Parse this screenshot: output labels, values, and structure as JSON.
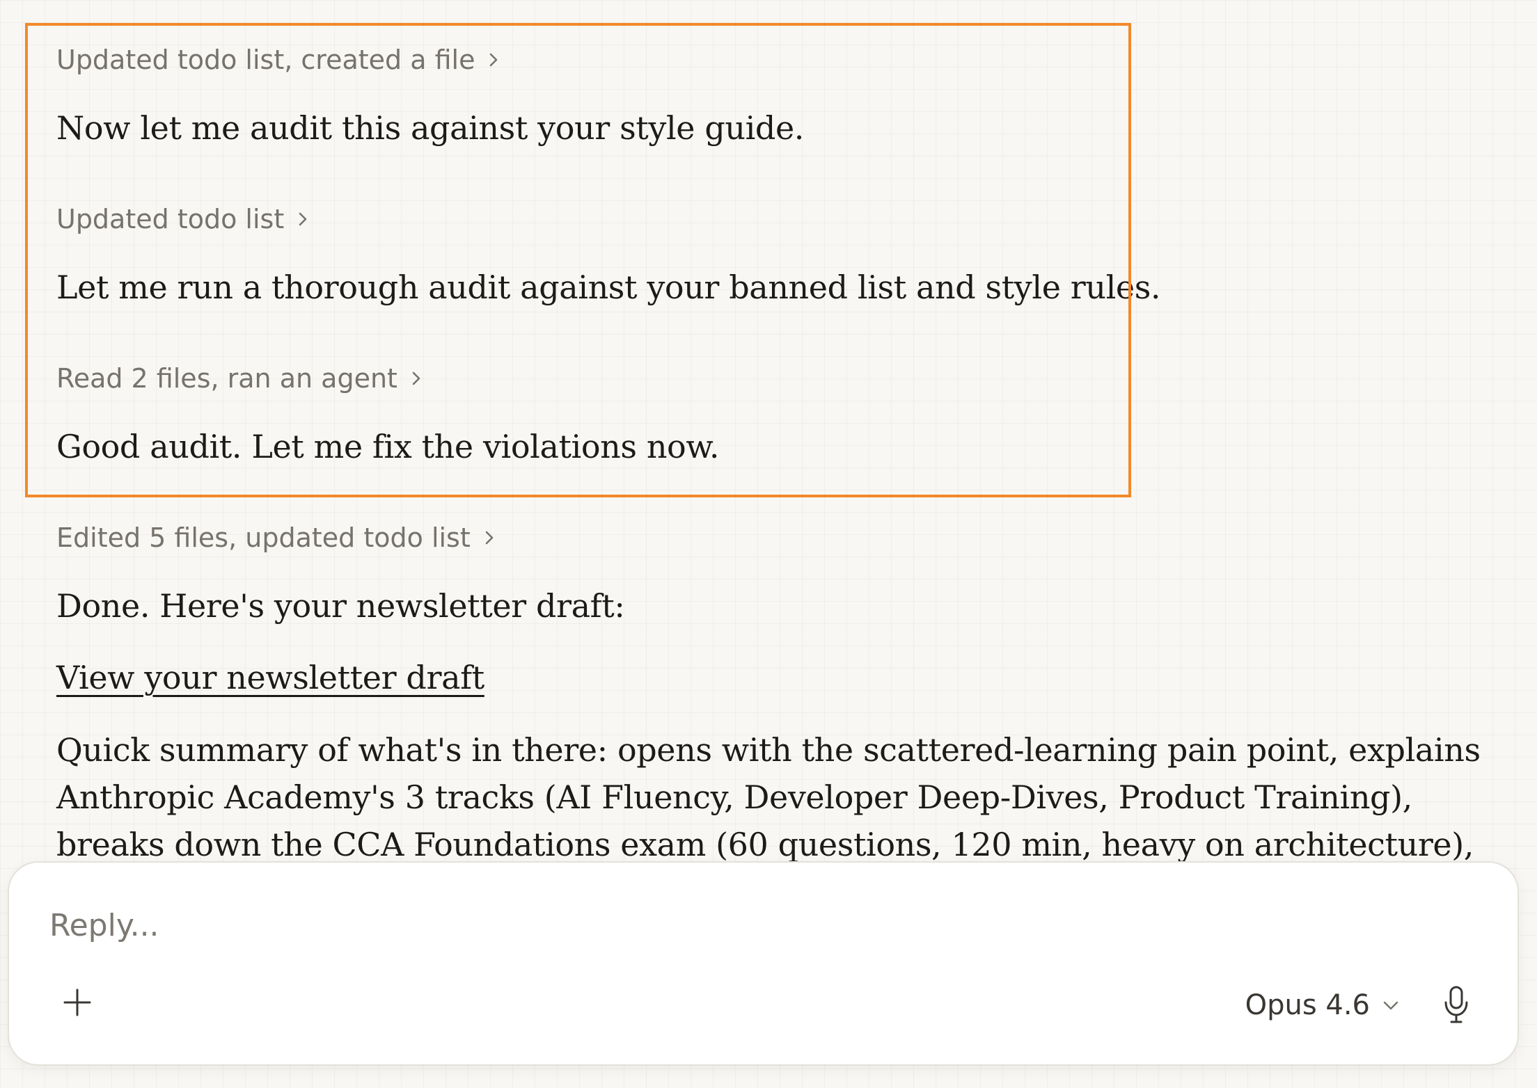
{
  "messages": {
    "step1": "Updated todo list, created a file",
    "msg1": "Now let me audit this against your style guide.",
    "step2": "Updated todo list",
    "msg2": "Let me run a thorough audit against your banned list and style rules.",
    "step3": "Read 2 files, ran an agent",
    "msg3": "Good audit. Let me fix the violations now.",
    "step4": "Edited 5 files, updated todo list",
    "msg4": "Done. Here's your newsletter draft:",
    "link": "View your newsletter draft",
    "summary_lines": [
      "Quick summary of what's in there: opens with the scattered-learning pain point, explains",
      "Anthropic Academy's 3 tracks (AI Fluency, Developer Deep-Dives, Product Training),",
      "breaks down the CCA Foundations exam (60 questions, 120 min, heavy on architecture),"
    ]
  },
  "composer": {
    "placeholder": "Reply...",
    "model": "Opus 4.6"
  },
  "colors": {
    "highlight_border": "#f2892a",
    "background": "#f8f7f4",
    "step_text": "#76726c",
    "body_text": "#1d1b18"
  },
  "icons": [
    "chevron-right-icon",
    "plus-icon",
    "chevron-down-icon",
    "microphone-icon"
  ]
}
